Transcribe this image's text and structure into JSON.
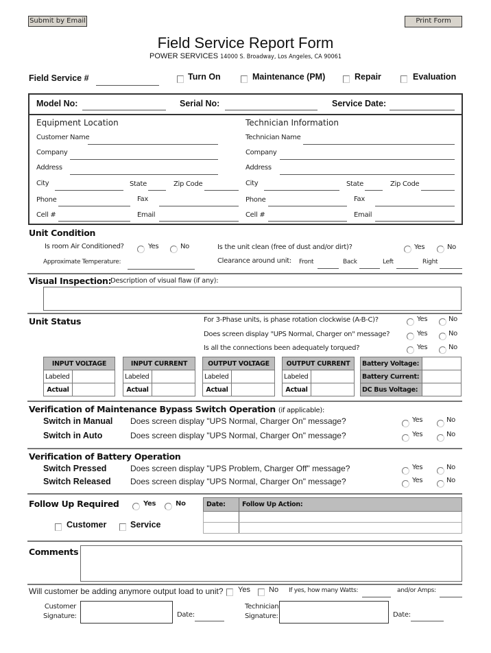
{
  "toolbar": {
    "submit_label": "Submit by Email",
    "print_label": "Print Form"
  },
  "header": {
    "title": "Field Service Report Form",
    "company": "POWER SERVICES",
    "address": "14000 S. Broadway, Los Angeles, CA  90061"
  },
  "service_type": {
    "field_service_label": "Field Service #",
    "field_service_value": "",
    "options": [
      {
        "label": "Turn On",
        "checked": false
      },
      {
        "label": "Maintenance (PM)",
        "checked": false
      },
      {
        "label": "Repair",
        "checked": false
      },
      {
        "label": "Evaluation",
        "checked": false
      }
    ]
  },
  "ids": {
    "model_label": "Model No:",
    "serial_label": "Serial No:",
    "date_label": "Service Date:"
  },
  "equipment": {
    "heading": "Equipment Location",
    "customer_name": "Customer Name",
    "company": "Company",
    "address": "Address",
    "city": "City",
    "state": "State",
    "zip": "Zip Code",
    "phone": "Phone",
    "fax": "Fax",
    "cell": "Cell #",
    "email": "Email"
  },
  "technician": {
    "heading": "Technician Information",
    "name": "Technician Name",
    "company": "Company",
    "address": "Address",
    "city": "City",
    "state": "State",
    "zip": "Zip Code",
    "phone": "Phone",
    "fax": "Fax",
    "cell": "Cell #",
    "email": "Email"
  },
  "unit_condition": {
    "heading": "Unit Condition",
    "air_conditioned_q": "Is room Air Conditioned?",
    "clean_q": "Is the unit clean (free of dust and/or dirt)?",
    "temp_label": "Approximate Temperature:",
    "clearance_label": "Clearance around unit:",
    "front": "Front",
    "back": "Back",
    "left": "Left",
    "right": "Right",
    "yes": "Yes",
    "no": "No"
  },
  "visual": {
    "heading": "Visual Inspection:",
    "description": "Description of visual flaw (if any):"
  },
  "unit_status": {
    "heading": "Unit Status",
    "questions": [
      "For 3-Phase units, is phase rotation clockwise (A-B-C)?",
      "Does screen display \"UPS Normal, Charger on\" message?",
      "Is all the connections been adequately torqued?"
    ],
    "yes": "Yes",
    "no": "No",
    "tables": [
      {
        "header": "INPUT VOLTAGE",
        "rows": [
          "Labeled",
          "Actual"
        ]
      },
      {
        "header": "INPUT CURRENT",
        "rows": [
          "Labeled",
          "Actual"
        ]
      },
      {
        "header": "OUTPUT VOLTAGE",
        "rows": [
          "Labeled",
          "Actual"
        ]
      },
      {
        "header": "OUTPUT CURRENT",
        "rows": [
          "Labeled",
          "Actual"
        ]
      }
    ],
    "battery": [
      "Battery Voltage:",
      "Battery Current:",
      "DC Bus Voltage:"
    ]
  },
  "bypass": {
    "heading": "Verification of Maintenance Bypass Switch Operation",
    "heading_note": "(if applicable):",
    "rows": [
      {
        "label": "Switch in Manual",
        "question": "Does screen display \"UPS Normal, Charger On\" message?"
      },
      {
        "label": "Switch in Auto",
        "question": "Does screen display \"UPS Normal, Charger On\" message?"
      }
    ],
    "yes": "Yes",
    "no": "No"
  },
  "battery_op": {
    "heading": "Verification of Battery Operation",
    "rows": [
      {
        "label": "Switch Pressed",
        "question": "Does screen display \"UPS Problem, Charger Off\" message?"
      },
      {
        "label": "Switch Released",
        "question": "Does screen display \"UPS Normal, Charger On\" message?"
      }
    ],
    "yes": "Yes",
    "no": "No"
  },
  "follow_up": {
    "heading": "Follow Up Required",
    "yes": "Yes",
    "no": "No",
    "customer": "Customer",
    "service": "Service",
    "date_col": "Date:",
    "action_col": "Follow Up Action:"
  },
  "comments": {
    "heading": "Comments"
  },
  "load": {
    "question": "Will customer be adding anymore output load to unit?",
    "yes": "Yes",
    "no": "No",
    "watts": "If yes, how many Watts:",
    "amps": "and/or Amps:"
  },
  "signatures": {
    "customer_l1": "Customer",
    "customer_l2": "Signature:",
    "technician_l1": "Technician",
    "technician_l2": "Signature:",
    "date": "Date:"
  }
}
